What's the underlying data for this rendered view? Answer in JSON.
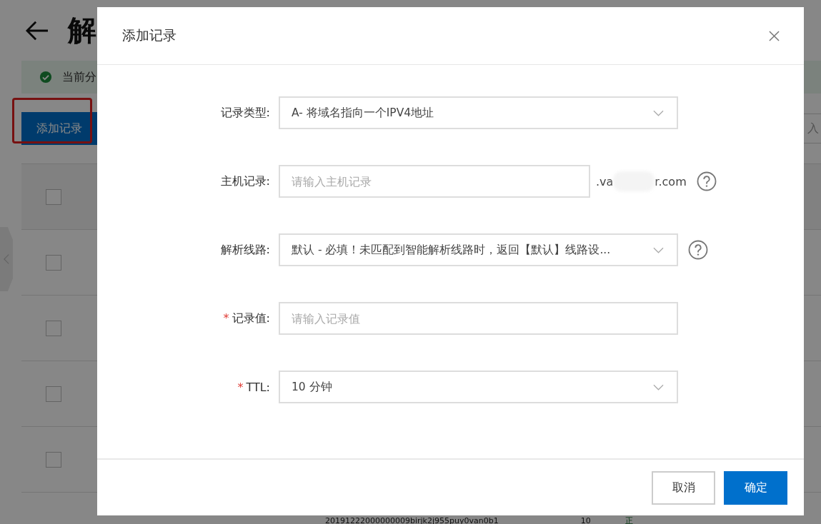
{
  "page": {
    "title": "解",
    "alert": "当前分",
    "add_button": "添加记录",
    "search_placeholder": "入",
    "table": {
      "rows": [
        {
          "checked": false
        },
        {
          "checked": false
        },
        {
          "checked": false
        },
        {
          "checked": false
        },
        {
          "checked": false
        }
      ],
      "partial_row": {
        "column_1": "20191222000000009birjk2j955puy0van0b1",
        "column_2": "10",
        "column_3": "正"
      }
    }
  },
  "dialog": {
    "title": "添加记录",
    "fields": [
      {
        "kind": "select",
        "label": "记录类型:",
        "value": "A- 将域名指向一个IPV4地址",
        "help": false
      },
      {
        "kind": "input",
        "label": "主机记录:",
        "placeholder": "请输入主机记录",
        "suffix_start": ".va",
        "suffix_end": "r.com",
        "help": true
      },
      {
        "kind": "select",
        "label": "解析线路:",
        "value": "默认 - 必填！未匹配到智能解析线路时，返回【默认】线路设...",
        "help": true
      },
      {
        "kind": "input",
        "label": "记录值:",
        "marker": "*",
        "placeholder": "请输入记录值",
        "help": false
      },
      {
        "kind": "select",
        "label": "TTL:",
        "marker": "*",
        "value": "10 分钟",
        "help": false
      }
    ],
    "buttons": [
      {
        "label": "取消",
        "kind": "secondary"
      },
      {
        "label": "确定",
        "kind": "primary"
      }
    ]
  }
}
